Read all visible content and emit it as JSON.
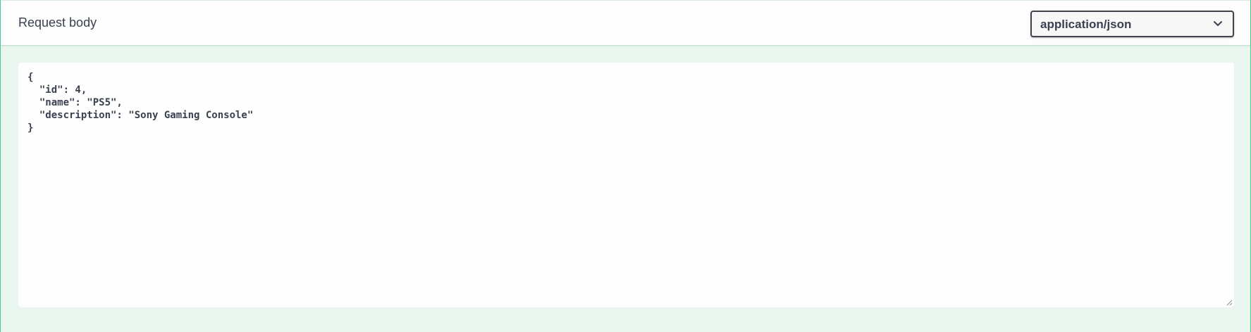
{
  "request_body": {
    "title": "Request body",
    "content_type": {
      "selected": "application/json",
      "icon": "chevron-down-icon"
    },
    "editor": {
      "value": "{\n  \"id\": 4,\n  \"name\": \"PS5\",\n  \"description\": \"Sony Gaming Console\"\n}"
    }
  },
  "colors": {
    "accent": "#49cc90",
    "panel_background": "#e8f6ef",
    "text": "#3b4151"
  }
}
